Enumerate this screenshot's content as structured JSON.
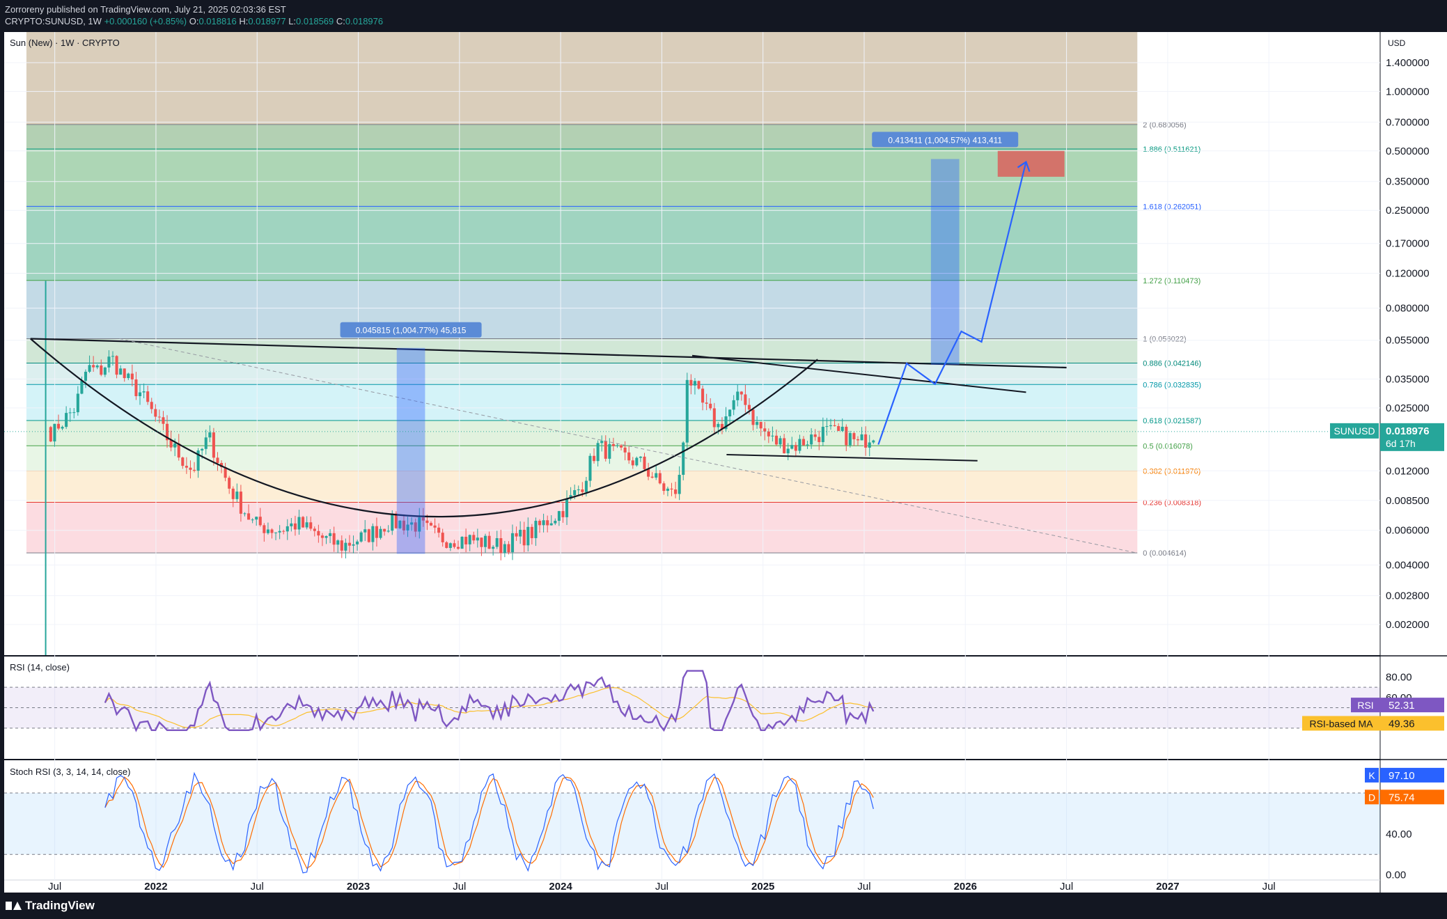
{
  "header": {
    "publish_line": "Zorroreny published on TradingView.com, July 21, 2025 02:03:36 EST",
    "symbol": "CRYPTO:SUNUSD, 1W",
    "change": "+0.000160 (+0.85%)",
    "ohlc": [
      {
        "label": "O:",
        "value": "0.018816"
      },
      {
        "label": "H:",
        "value": "0.018977"
      },
      {
        "label": "L:",
        "value": "0.018569"
      },
      {
        "label": "C:",
        "value": "0.018976"
      }
    ]
  },
  "legend": {
    "main": "Sun (New) · 1W · CRYPTO",
    "rsi": "RSI (14, close)",
    "stoch": "Stoch RSI (3, 3, 14, 14, close)"
  },
  "currency": "USD",
  "footer": {
    "brand": "TradingView"
  },
  "colors": {
    "background": "#ffffff",
    "up": "#26a69a",
    "down": "#ef5350",
    "rsi_line": "#7e57c2",
    "rsi_ma": "#fbc02d",
    "stoch_k": "#2962ff",
    "stoch_d": "#ff6d00",
    "projection": "#2962ff"
  },
  "chart_data": [
    {
      "type": "candlestick",
      "title": "Sun (New) · 1W · CRYPTO",
      "y_scale": "log",
      "y_ticks": [
        "1.400000",
        "1.000000",
        "0.700000",
        "0.500000",
        "0.350000",
        "0.250000",
        "0.170000",
        "0.120000",
        "0.080000",
        "0.055000",
        "0.035000",
        "0.025000",
        "0.012000",
        "0.008500",
        "0.006000",
        "0.004000",
        "0.002800",
        "0.002000"
      ],
      "x_ticks": [
        "Jul",
        "2022",
        "Jul",
        "2023",
        "Jul",
        "2024",
        "Jul",
        "2025",
        "Jul",
        "2026",
        "Jul",
        "2027",
        "Jul"
      ],
      "ylim": [
        0.0014,
        2.0
      ],
      "xlim": [
        2021.25,
        2028.05
      ],
      "price_label": {
        "symbol": "SUNUSD",
        "value": "0.018976",
        "countdown": "6d 17h"
      },
      "fib_levels": [
        {
          "label": "2 (0.680056)",
          "value": 0.680056,
          "color": "#787b86",
          "fill": "#c8b89a"
        },
        {
          "label": "1.886 (0.511621)",
          "value": 0.511621,
          "color": "#089981",
          "fill": "#a6c8a6"
        },
        {
          "label": "1.618 (0.262051)",
          "value": 0.262051,
          "color": "#2962ff",
          "fill": "#9fcfa8"
        },
        {
          "label": "1.272 (0.110473)",
          "value": 0.110473,
          "color": "#43a047",
          "fill": "#8fcdb5"
        },
        {
          "label": "1 (0.056022)",
          "value": 0.056022,
          "color": "#787b86",
          "fill": "#b8d4e2"
        },
        {
          "label": "0.886 (0.042146)",
          "value": 0.042146,
          "color": "#00897b",
          "fill": "#c9e3cf"
        },
        {
          "label": "0.786 (0.032835)",
          "value": 0.032835,
          "color": "#0097a7",
          "fill": "#d6ecec"
        },
        {
          "label": "0.618 (0.021587)",
          "value": 0.021587,
          "color": "#009688",
          "fill": "#cdf1f7"
        },
        {
          "label": "0.5 (0.016078)",
          "value": 0.016078,
          "color": "#43a047",
          "fill": "#dcf0d8"
        },
        {
          "label": "0.382 (0.011976)",
          "value": 0.011976,
          "color": "#f57c00",
          "fill": "#e4f4e2"
        },
        {
          "label": "0.236 (0.008318)",
          "value": 0.008318,
          "color": "#e53935",
          "fill": "#fdebcf"
        },
        {
          "label": "0 (0.004614)",
          "value": 0.004614,
          "color": "#787b86",
          "fill": "#fbd6dc"
        }
      ],
      "measure_labels": [
        "0.045815 (1,004.77%) 45,815",
        "0.413411 (1,004.57%) 413,411"
      ],
      "annotations": [
        "cup and handle curve",
        "descending resistance line",
        "projected path to target box"
      ]
    },
    {
      "type": "line",
      "title": "RSI (14, close)",
      "y_ticks": [
        "80.00",
        "60.00"
      ],
      "ylim": [
        0,
        100
      ],
      "bands": [
        30,
        50,
        70
      ],
      "series": [
        {
          "name": "RSI",
          "last": "52.31"
        },
        {
          "name": "RSI-based MA",
          "last": "49.36"
        }
      ]
    },
    {
      "type": "line",
      "title": "Stoch RSI (3, 3, 14, 14, close)",
      "y_ticks": [
        "40.00",
        "0.00"
      ],
      "ylim": [
        -5,
        112
      ],
      "bands": [
        20,
        80
      ],
      "series": [
        {
          "name": "K",
          "last": "97.10"
        },
        {
          "name": "D",
          "last": "75.74"
        }
      ]
    }
  ]
}
